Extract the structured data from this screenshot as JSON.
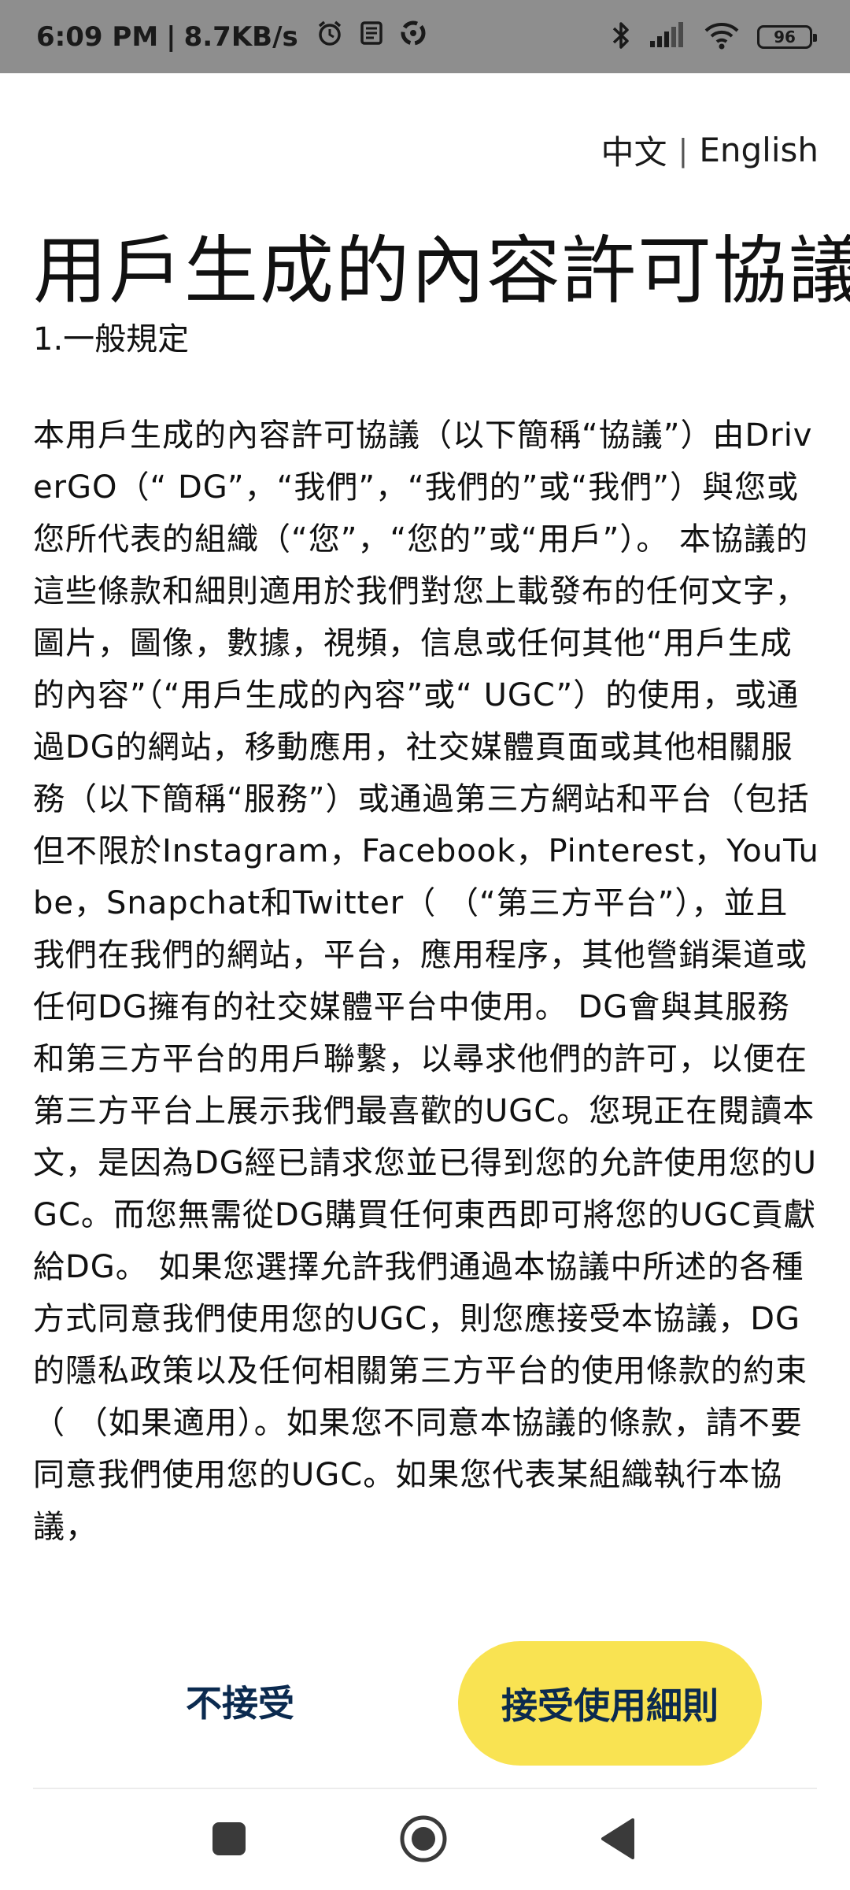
{
  "status_bar": {
    "time": "6:09 PM",
    "separator": "|",
    "network_speed": "8.7KB/s",
    "battery_level": "96",
    "icons": [
      "alarm-icon",
      "news-icon",
      "sync-icon",
      "bluetooth-icon",
      "signal-icon",
      "wifi-icon",
      "battery-icon"
    ]
  },
  "language": {
    "chinese": "中文",
    "divider": "|",
    "english": "English"
  },
  "page": {
    "title": "用戶生成的內容許可協議",
    "section_heading": "1.一般規定",
    "body": "本用戶生成的內容許可協議（以下簡稱“協議”）由DriverGO（“ DG”，“我們”，“我們的”或“我們”）與您或您所代表的組織（“您”，“您的”或“用戶”）。 本協議的這些條款和細則適用於我們對您上載發布的任何文字，圖片，圖像，數據，視頻，信息或任何其他“用戶生成的內容”（“用戶生成的內容”或“ UGC”）的使用，或通過DG的網站，移動應用，社交媒體頁面或其他相關服務（以下簡稱“服務”）或通過第三方網站和平台（包括但不限於Instagram，Facebook，Pinterest，YouTube，Snapchat和Twitter（ （“第三方平台”），並且我們在我們的網站，平台，應用程序，其他營銷渠道或任何DG擁有的社交媒體平台中使用。 DG會與其服務和第三方平台的用戶聯繫，以尋求他們的許可，以便在第三方平台上展示我們最喜歡的UGC。您現正在閱讀本文，是因為DG經已請求您並已得到您的允許使用您的UGC。而您無需從DG購買任何東西即可將您的UGC貢獻給DG。 如果您選擇允許我們通過本協議中所述的各種方式同意我們使用您的UGC，則您應接受本協議，DG的隱私政策以及任何相關第三方平台的使用條款的約束（ （如果適用）。如果您不同意本協議的條款，請不要同意我們使用您的UGC。如果您代表某組織執行本協議，"
  },
  "actions": {
    "decline_label": "不接受",
    "accept_label": "接受使用細則"
  },
  "colors": {
    "accent": "#f9e352",
    "button_text": "#0b2a4f",
    "status_bar": "#8e8e8e"
  },
  "nav_bar": {
    "icons": [
      "recents-icon",
      "home-icon",
      "back-icon"
    ]
  }
}
